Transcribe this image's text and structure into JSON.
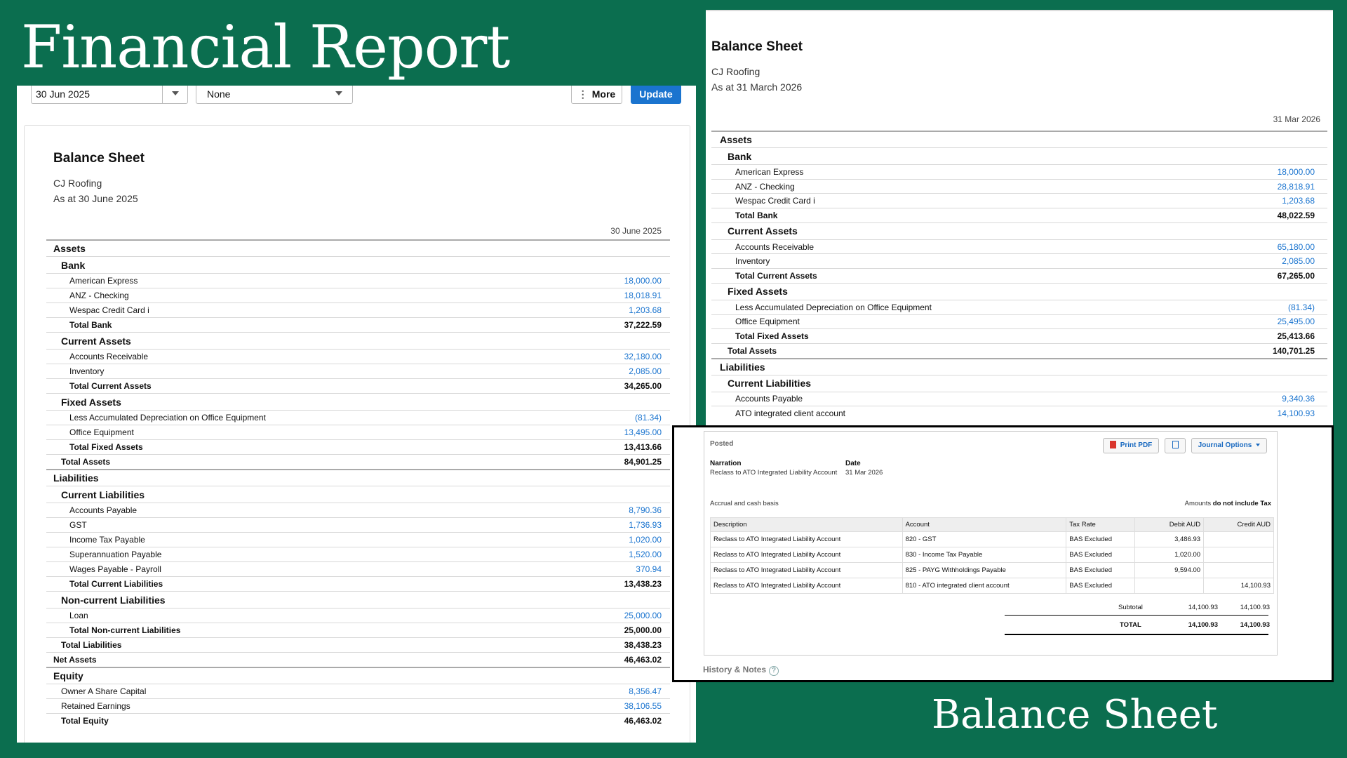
{
  "title": "Financial Report",
  "footer_title": "Balance Sheet",
  "toolbar": {
    "date": "30 Jun 2025",
    "compare": "None",
    "more": "More",
    "more_icon": "⋮",
    "update": "Update"
  },
  "left_report": {
    "heading": "Balance Sheet",
    "company": "CJ Roofing",
    "as_at": "As at 30 June 2025",
    "column": "30 June 2025",
    "rows": [
      {
        "type": "section",
        "label": "Assets"
      },
      {
        "type": "group",
        "label": "Bank"
      },
      {
        "type": "item",
        "label": "American Express",
        "amount": "18,000.00"
      },
      {
        "type": "item",
        "label": "ANZ - Checking",
        "amount": "18,018.91"
      },
      {
        "type": "item",
        "label": "Wespac Credit Card i",
        "amount": "1,203.68"
      },
      {
        "type": "total",
        "level": 1,
        "label": "Total Bank",
        "amount": "37,222.59"
      },
      {
        "type": "group",
        "label": "Current Assets"
      },
      {
        "type": "item",
        "label": "Accounts Receivable",
        "amount": "32,180.00"
      },
      {
        "type": "item",
        "label": "Inventory",
        "amount": "2,085.00"
      },
      {
        "type": "total",
        "level": 1,
        "label": "Total Current Assets",
        "amount": "34,265.00"
      },
      {
        "type": "group",
        "label": "Fixed Assets"
      },
      {
        "type": "item",
        "label": "Less Accumulated Depreciation on Office Equipment",
        "amount": "(81.34)"
      },
      {
        "type": "item",
        "label": "Office Equipment",
        "amount": "13,495.00"
      },
      {
        "type": "total",
        "level": 1,
        "label": "Total Fixed Assets",
        "amount": "13,413.66"
      },
      {
        "type": "total",
        "level": 2,
        "label": "Total Assets",
        "amount": "84,901.25"
      },
      {
        "type": "section",
        "label": "Liabilities"
      },
      {
        "type": "group",
        "label": "Current Liabilities"
      },
      {
        "type": "item",
        "label": "Accounts Payable",
        "amount": "8,790.36"
      },
      {
        "type": "item",
        "label": "GST",
        "amount": "1,736.93"
      },
      {
        "type": "item",
        "label": "Income Tax Payable",
        "amount": "1,020.00"
      },
      {
        "type": "item",
        "label": "Superannuation Payable",
        "amount": "1,520.00"
      },
      {
        "type": "item",
        "label": "Wages Payable - Payroll",
        "amount": "370.94"
      },
      {
        "type": "total",
        "level": 1,
        "label": "Total Current Liabilities",
        "amount": "13,438.23"
      },
      {
        "type": "group",
        "label": "Non-current Liabilities"
      },
      {
        "type": "item",
        "label": "Loan",
        "amount": "25,000.00"
      },
      {
        "type": "total",
        "level": 1,
        "label": "Total Non-current Liabilities",
        "amount": "25,000.00"
      },
      {
        "type": "total",
        "level": 2,
        "label": "Total Liabilities",
        "amount": "38,438.23"
      },
      {
        "type": "total",
        "level": 3,
        "label": "Net Assets",
        "amount": "46,463.02"
      },
      {
        "type": "section",
        "label": "Equity"
      },
      {
        "type": "itemg",
        "label": "Owner A Share Capital",
        "amount": "8,356.47"
      },
      {
        "type": "itemg",
        "label": "Retained Earnings",
        "amount": "38,106.55"
      },
      {
        "type": "total",
        "level": 2,
        "label": "Total Equity",
        "amount": "46,463.02"
      }
    ]
  },
  "right_report": {
    "heading": "Balance Sheet",
    "company": "CJ Roofing",
    "as_at": "As at 31 March 2026",
    "column": "31 Mar 2026",
    "rows": [
      {
        "type": "section",
        "label": "Assets"
      },
      {
        "type": "group",
        "label": "Bank"
      },
      {
        "type": "item",
        "label": "American Express",
        "amount": "18,000.00"
      },
      {
        "type": "item",
        "label": "ANZ - Checking",
        "amount": "28,818.91"
      },
      {
        "type": "item",
        "label": "Wespac Credit Card i",
        "amount": "1,203.68"
      },
      {
        "type": "total",
        "level": 1,
        "label": "Total Bank",
        "amount": "48,022.59"
      },
      {
        "type": "group",
        "label": "Current Assets"
      },
      {
        "type": "item",
        "label": "Accounts Receivable",
        "amount": "65,180.00"
      },
      {
        "type": "item",
        "label": "Inventory",
        "amount": "2,085.00"
      },
      {
        "type": "total",
        "level": 1,
        "label": "Total Current Assets",
        "amount": "67,265.00"
      },
      {
        "type": "group",
        "label": "Fixed Assets"
      },
      {
        "type": "item",
        "label": "Less Accumulated Depreciation on Office Equipment",
        "amount": "(81.34)"
      },
      {
        "type": "item",
        "label": "Office Equipment",
        "amount": "25,495.00"
      },
      {
        "type": "total",
        "level": 1,
        "label": "Total Fixed Assets",
        "amount": "25,413.66"
      },
      {
        "type": "total",
        "level": 2,
        "label": "Total Assets",
        "amount": "140,701.25"
      },
      {
        "type": "section",
        "label": "Liabilities"
      },
      {
        "type": "group",
        "label": "Current Liabilities"
      },
      {
        "type": "item",
        "label": "Accounts Payable",
        "amount": "9,340.36"
      },
      {
        "type": "item",
        "label": "ATO integrated client account",
        "amount": "14,100.93"
      }
    ]
  },
  "journal": {
    "status": "Posted",
    "print_pdf": "Print PDF",
    "journal_options": "Journal Options",
    "narration_label": "Narration",
    "narration": "Reclass to ATO Integrated Liability Account",
    "date_label": "Date",
    "date": "31 Mar 2026",
    "basis": "Accrual and cash basis",
    "amounts_prefix": "Amounts",
    "amounts_note": "do not include Tax",
    "columns": [
      "Description",
      "Account",
      "Tax Rate",
      "Debit AUD",
      "Credit AUD"
    ],
    "lines": [
      {
        "description": "Reclass to ATO Integrated Liability Account",
        "account": "820 - GST",
        "tax": "BAS Excluded",
        "debit": "3,486.93",
        "credit": ""
      },
      {
        "description": "Reclass to ATO Integrated Liability Account",
        "account": "830 - Income Tax Payable",
        "tax": "BAS Excluded",
        "debit": "1,020.00",
        "credit": ""
      },
      {
        "description": "Reclass to ATO Integrated Liability Account",
        "account": "825 - PAYG Withholdings Payable",
        "tax": "BAS Excluded",
        "debit": "9,594.00",
        "credit": ""
      },
      {
        "description": "Reclass to ATO Integrated Liability Account",
        "account": "810 - ATO integrated client account",
        "tax": "BAS Excluded",
        "debit": "",
        "credit": "14,100.93"
      }
    ],
    "subtotal_label": "Subtotal",
    "subtotal_debit": "14,100.93",
    "subtotal_credit": "14,100.93",
    "total_label": "TOTAL",
    "total_debit": "14,100.93",
    "total_credit": "14,100.93",
    "history": "History & Notes",
    "help": "?"
  }
}
